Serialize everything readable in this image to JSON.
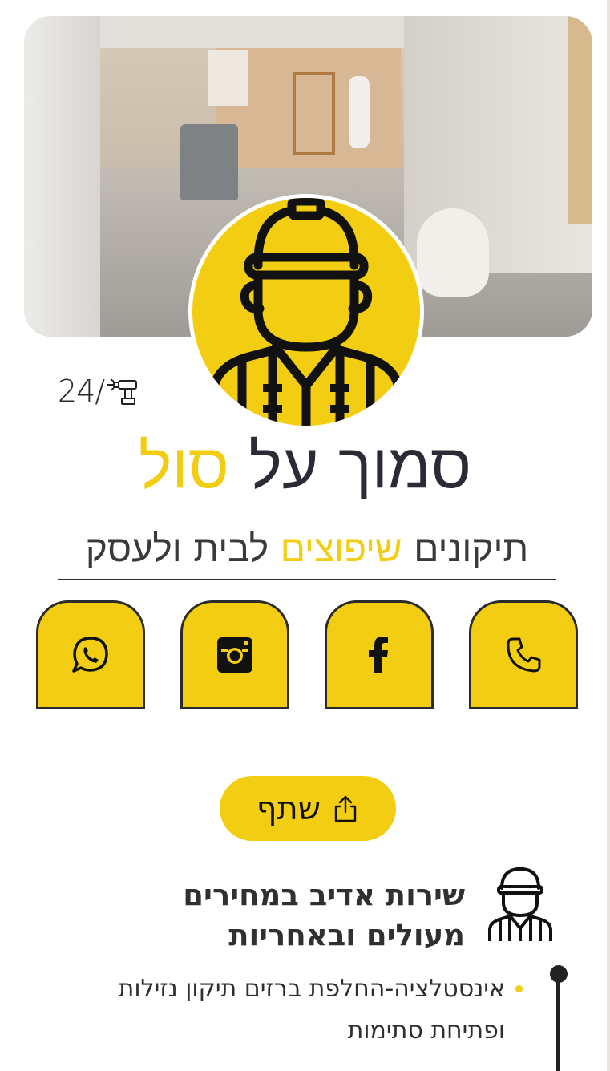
{
  "hours": {
    "label": "24/"
  },
  "title": {
    "part1": "סמוך על ",
    "accent": "סול"
  },
  "subtitle": {
    "part1": "תיקונים ",
    "accent": "שיפוצים",
    "part2": " לבית ולעסק"
  },
  "social": [
    {
      "name": "phone",
      "icon": "phone-icon"
    },
    {
      "name": "facebook",
      "icon": "facebook-icon"
    },
    {
      "name": "instagram",
      "icon": "instagram-icon"
    },
    {
      "name": "whatsapp",
      "icon": "whatsapp-icon"
    }
  ],
  "share": {
    "label": "שתף",
    "icon": "share-icon"
  },
  "service": {
    "heading_line1": "שירות אדיב במחירים",
    "heading_line2": "מעולים ובאחריות",
    "bullet_line1": "אינסטלציה-החלפת ברזים תיקון נזילות",
    "bullet_line2": "ופתיחת סתימות"
  },
  "colors": {
    "accent": "#f2cd12",
    "dark": "#2b2b2b",
    "background": "#ffffff"
  }
}
